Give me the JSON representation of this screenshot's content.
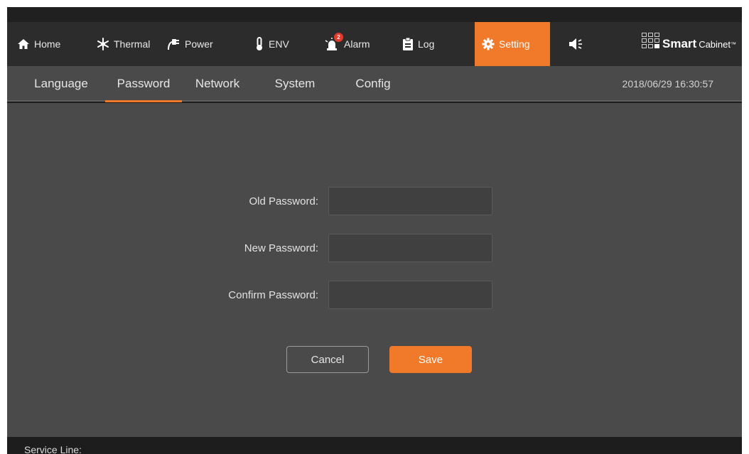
{
  "nav": {
    "items": [
      {
        "label": "Home",
        "icon": "home-icon"
      },
      {
        "label": "Thermal",
        "icon": "snowflake-icon"
      },
      {
        "label": "Power",
        "icon": "plug-icon"
      },
      {
        "label": "ENV",
        "icon": "thermometer-icon"
      },
      {
        "label": "Alarm",
        "icon": "alarm-bell-icon",
        "badge": "2"
      },
      {
        "label": "Log",
        "icon": "clipboard-icon"
      },
      {
        "label": "Setting",
        "icon": "gear-icon",
        "active": true
      }
    ],
    "speaker_icon": "speaker-icon",
    "brand": {
      "smart": "Smart",
      "cabinet": "Cabinet",
      "tm": "™"
    }
  },
  "subnav": {
    "tabs": [
      {
        "label": "Language"
      },
      {
        "label": "Password",
        "active": true
      },
      {
        "label": "Network"
      },
      {
        "label": "System"
      },
      {
        "label": "Config"
      }
    ],
    "datetime": "2018/06/29 16:30:57"
  },
  "form": {
    "old_password_label": "Old Password:",
    "old_password_value": "",
    "new_password_label": "New Password:",
    "new_password_value": "",
    "confirm_password_label": "Confirm Password:",
    "confirm_password_value": "",
    "cancel_label": "Cancel",
    "save_label": "Save"
  },
  "footer": {
    "service_line": "Service Line:"
  },
  "colors": {
    "accent": "#f07a2a",
    "panel": "#4a4a4a",
    "nav_bg": "#2c2c2c",
    "badge": "#e23a2a"
  }
}
